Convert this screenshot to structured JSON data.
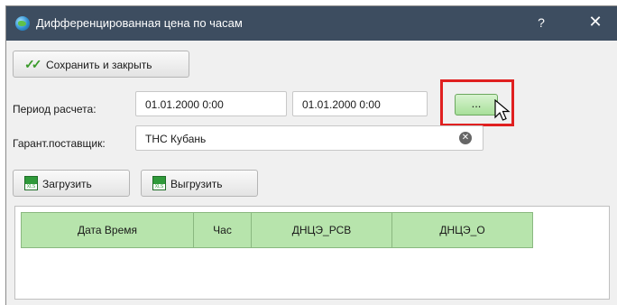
{
  "window": {
    "title": "Дифференцированная цена по часам",
    "help": "?",
    "close": "✕"
  },
  "toolbar": {
    "save_close_label": "Сохранить и закрыть"
  },
  "form": {
    "period_label": "Период расчета:",
    "date_from": "01.01.2000 0:00",
    "date_to": "01.01.2000 0:00",
    "pick_button_label": "...",
    "supplier_label": "Гарант.поставщик:",
    "supplier_value": "ТНС Кубань"
  },
  "actions": {
    "load_label": "Загрузить",
    "unload_label": "Выгрузить"
  },
  "table": {
    "columns": [
      "Дата Время",
      "Час",
      "ДНЦЭ_РСВ",
      "ДНЦЭ_О"
    ]
  },
  "icons": {
    "app": "globe-icon",
    "check": "check-icon",
    "excel": "excel-icon",
    "clear": "clear-icon",
    "cursor": "mouse-cursor-icon"
  },
  "colors": {
    "titlebar": "#3d4d60",
    "header_green": "#b7e4ac",
    "highlight": "#e02020"
  }
}
